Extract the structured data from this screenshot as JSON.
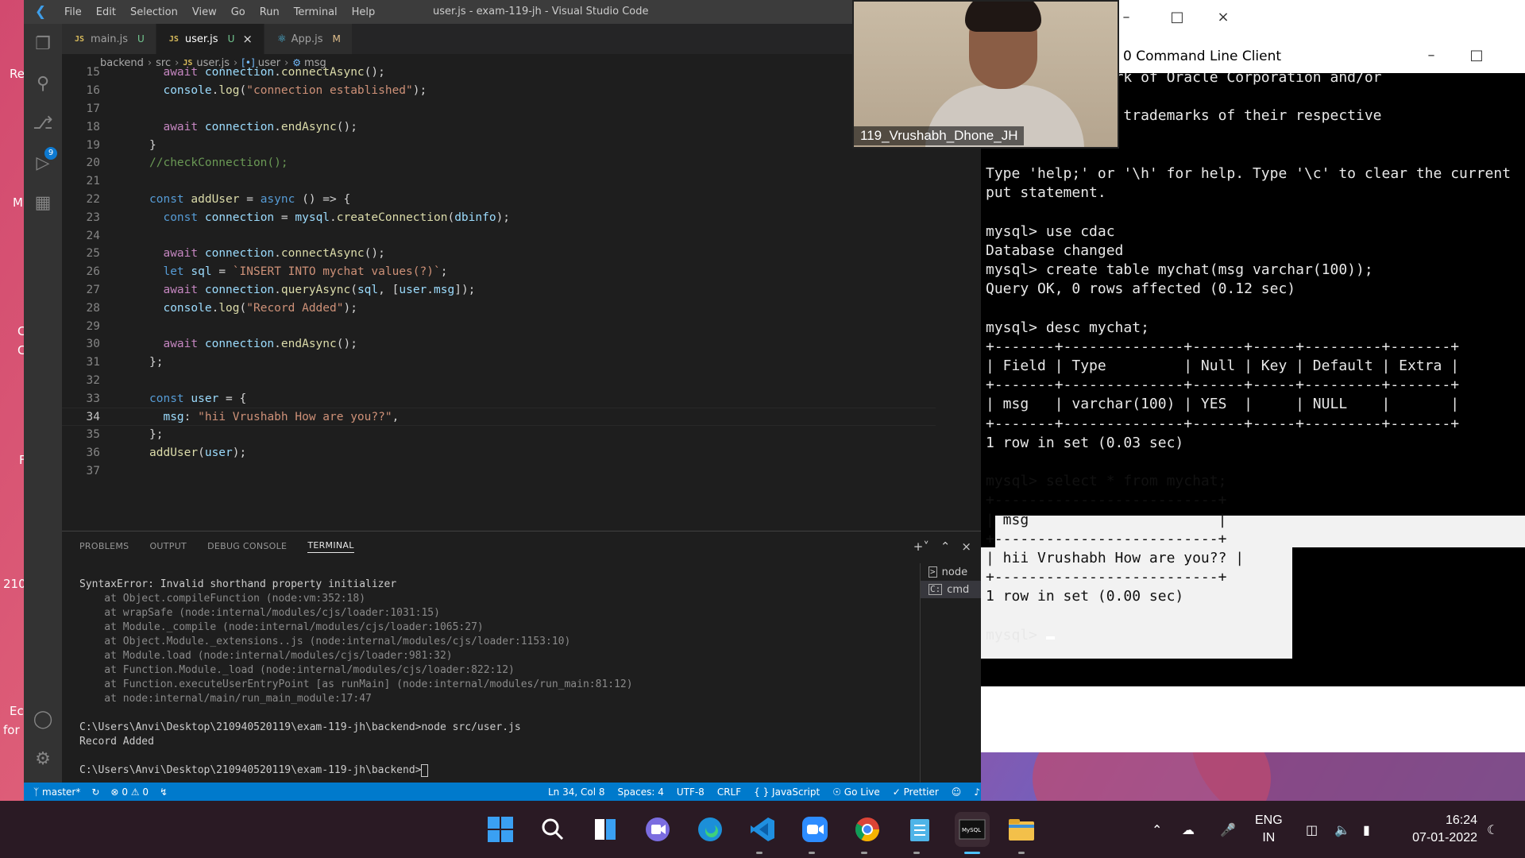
{
  "vscode": {
    "menu": [
      "File",
      "Edit",
      "Selection",
      "View",
      "Go",
      "Run",
      "Terminal",
      "Help"
    ],
    "window_title": "user.js - exam-119-jh - Visual Studio Code",
    "tabs": [
      {
        "label": "main.js",
        "status": "U",
        "type": "js"
      },
      {
        "label": "user.js",
        "status": "U",
        "type": "js",
        "active": true
      },
      {
        "label": "App.js",
        "status": "M",
        "type": "react"
      }
    ],
    "breadcrumb": [
      "backend",
      "src",
      "user.js",
      "user",
      "msg"
    ],
    "activity_badge": "9",
    "code_lines": [
      {
        "n": "15",
        "t": "  await connection.connectAsync();"
      },
      {
        "n": "16",
        "t": "  console.log(\"connection established\");"
      },
      {
        "n": "17",
        "t": ""
      },
      {
        "n": "18",
        "t": "  await connection.endAsync();"
      },
      {
        "n": "19",
        "t": "}"
      },
      {
        "n": "20",
        "t": "//checkConnection();"
      },
      {
        "n": "21",
        "t": ""
      },
      {
        "n": "22",
        "t": "const addUser = async () => {"
      },
      {
        "n": "23",
        "t": "  const connection = mysql.createConnection(dbinfo);"
      },
      {
        "n": "24",
        "t": ""
      },
      {
        "n": "25",
        "t": "  await connection.connectAsync();"
      },
      {
        "n": "26",
        "t": "  let sql = `INSERT INTO mychat values(?)`;"
      },
      {
        "n": "27",
        "t": "  await connection.queryAsync(sql, [user.msg]);"
      },
      {
        "n": "28",
        "t": "  console.log(\"Record Added\");"
      },
      {
        "n": "29",
        "t": ""
      },
      {
        "n": "30",
        "t": "  await connection.endAsync();"
      },
      {
        "n": "31",
        "t": "};"
      },
      {
        "n": "32",
        "t": ""
      },
      {
        "n": "33",
        "t": "const user = {"
      },
      {
        "n": "34",
        "t": "  msg: \"hii Vrushabh How are you??\","
      },
      {
        "n": "35",
        "t": "};"
      },
      {
        "n": "36",
        "t": "addUser(user);"
      },
      {
        "n": "37",
        "t": ""
      }
    ],
    "panel_tabs": [
      "PROBLEMS",
      "OUTPUT",
      "DEBUG CONSOLE",
      "TERMINAL"
    ],
    "terminal_lines": [
      {
        "t": "SyntaxError: Invalid shorthand property initializer",
        "dim": false
      },
      {
        "t": "    at Object.compileFunction (node:vm:352:18)",
        "dim": true
      },
      {
        "t": "    at wrapSafe (node:internal/modules/cjs/loader:1031:15)",
        "dim": true
      },
      {
        "t": "    at Module._compile (node:internal/modules/cjs/loader:1065:27)",
        "dim": true
      },
      {
        "t": "    at Object.Module._extensions..js (node:internal/modules/cjs/loader:1153:10)",
        "dim": true
      },
      {
        "t": "    at Module.load (node:internal/modules/cjs/loader:981:32)",
        "dim": true
      },
      {
        "t": "    at Function.Module._load (node:internal/modules/cjs/loader:822:12)",
        "dim": true
      },
      {
        "t": "    at Function.executeUserEntryPoint [as runMain] (node:internal/modules/run_main:81:12)",
        "dim": true
      },
      {
        "t": "    at node:internal/main/run_main_module:17:47",
        "dim": true
      },
      {
        "t": "",
        "dim": false
      },
      {
        "t": "C:\\Users\\Anvi\\Desktop\\210940520119\\exam-119-jh\\backend>node src/user.js",
        "dim": false
      },
      {
        "t": "Record Added",
        "dim": false
      },
      {
        "t": "",
        "dim": false
      }
    ],
    "terminal_prompt": "C:\\Users\\Anvi\\Desktop\\210940520119\\exam-119-jh\\backend>",
    "terminal_sessions": [
      {
        "label": "node",
        "icon": "terminal-icon"
      },
      {
        "label": "cmd",
        "icon": "cmd-icon"
      }
    ],
    "statusbar": {
      "branch": "master*",
      "problems": "0",
      "warnings": "0",
      "position": "Ln 34, Col 8",
      "spaces": "Spaces: 4",
      "encoding": "UTF-8",
      "eol": "CRLF",
      "language": "JavaScript",
      "golive": "Go Live",
      "prettier": "Prettier"
    }
  },
  "mysql": {
    "title": "0 Command Line Client",
    "lines": [
      {
        "t": "istered trademark of Oracle Corporation and/or"
      },
      {
        "t": ""
      },
      {
        "t": "er names may be trademarks of their respective"
      },
      {
        "t": ""
      },
      {
        "t": ""
      },
      {
        "t": "Type 'help;' or '\\h' for help. Type '\\c' to clear the current"
      },
      {
        "t": "put statement."
      },
      {
        "t": ""
      },
      {
        "t": "mysql> use cdac"
      },
      {
        "t": "Database changed"
      },
      {
        "t": "mysql> create table mychat(msg varchar(100));"
      },
      {
        "t": "Query OK, 0 rows affected (0.12 sec)"
      },
      {
        "t": ""
      },
      {
        "t": "mysql> desc mychat;"
      },
      {
        "t": "+-------+--------------+------+-----+---------+-------+"
      },
      {
        "t": "| Field | Type         | Null | Key | Default | Extra |"
      },
      {
        "t": "+-------+--------------+------+-----+---------+-------+"
      },
      {
        "t": "| msg   | varchar(100) | YES  |     | NULL    |       |"
      },
      {
        "t": "+-------+--------------+------+-----+---------+-------+"
      },
      {
        "t": "1 row in set (0.03 sec)"
      },
      {
        "t": ""
      },
      {
        "t": "mysql> select * from mychat;",
        "hl": true
      },
      {
        "t": "+--------------------------+",
        "hl": true
      },
      {
        "t": "| msg                      |",
        "hl": true
      },
      {
        "t": "+--------------------------+",
        "hl": true
      },
      {
        "t": "| hii Vrushabh How are you?? |",
        "hl": true
      },
      {
        "t": "+--------------------------+",
        "hl": true
      },
      {
        "t": "1 row in set (0.00 sec)",
        "hl": true
      },
      {
        "t": ""
      },
      {
        "t": "mysql> "
      }
    ]
  },
  "webcam": {
    "name": "119_Vrushabh_Dhone_JH"
  },
  "desktop": {
    "labels": [
      "Re",
      "M",
      "C",
      "C",
      "F",
      "210",
      "Ec",
      "for"
    ]
  },
  "taskbar": {
    "apps": [
      "start-icon",
      "search-icon",
      "widgets-icon",
      "teams-chat-icon",
      "edge-icon",
      "vscode-icon",
      "zoom-icon",
      "chrome-icon",
      "notepad-icon",
      "mysql-icon",
      "file-explorer-icon"
    ],
    "lang_top": "ENG",
    "lang_bottom": "IN",
    "time": "16:24",
    "date": "07-01-2022"
  }
}
